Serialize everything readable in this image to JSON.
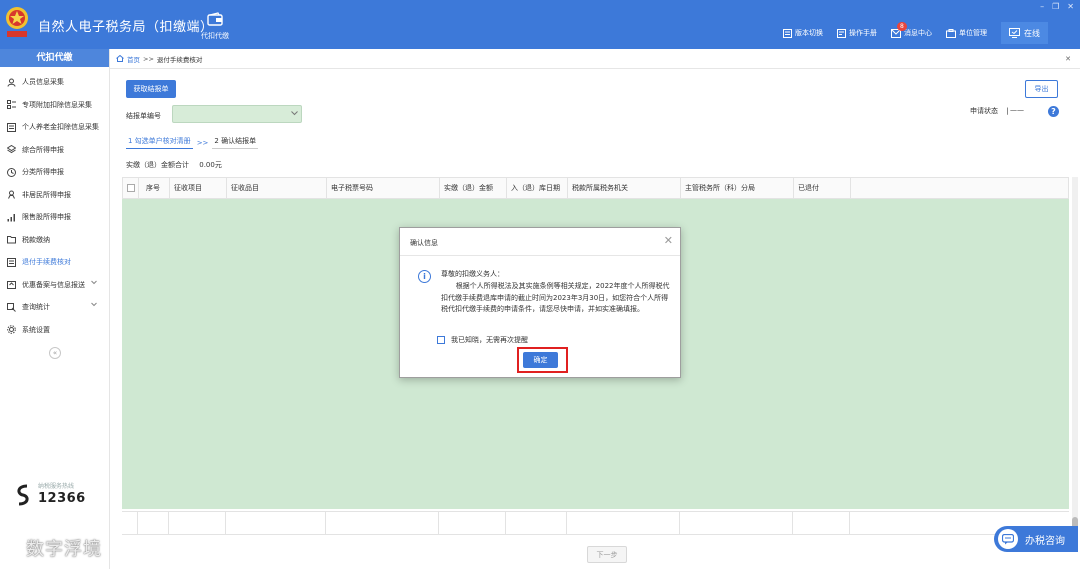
{
  "header": {
    "app_title": "自然人电子税务局（扣缴端）",
    "module_label": "代扣代缴",
    "actions": [
      {
        "label": "版本切换",
        "icon": "version-icon"
      },
      {
        "label": "操作手册",
        "icon": "manual-icon"
      },
      {
        "label": "消息中心",
        "icon": "message-icon",
        "badge": "8"
      },
      {
        "label": "单位管理",
        "icon": "org-icon"
      }
    ],
    "online_label": "在线",
    "colors": {
      "primary": "#3d79d9",
      "sidebar_head": "#4e86dc",
      "table_body": "#cfe8d2",
      "highlight": "#e02020"
    }
  },
  "sidebar": {
    "title": "代扣代缴",
    "items": [
      {
        "label": "人员信息采集",
        "icon": "person-icon"
      },
      {
        "label": "专项附加扣除信息采集",
        "icon": "list-icon"
      },
      {
        "label": "个人养老金扣除信息采集",
        "icon": "doc-icon"
      },
      {
        "label": "综合所得申报",
        "icon": "layers-icon"
      },
      {
        "label": "分类所得申报",
        "icon": "clock-icon"
      },
      {
        "label": "非居民所得申报",
        "icon": "person-outline-icon"
      },
      {
        "label": "限售股所得申报",
        "icon": "chart-icon"
      },
      {
        "label": "税款缴纳",
        "icon": "folder-icon"
      },
      {
        "label": "退付手续费核对",
        "icon": "receipt-icon"
      },
      {
        "label": "优惠备案与信息报送",
        "icon": "upload-icon"
      },
      {
        "label": "查询统计",
        "icon": "search-icon"
      },
      {
        "label": "系统设置",
        "icon": "gear-icon"
      }
    ],
    "collapse_glyph": "«",
    "hotline_caption": "纳税服务热线",
    "hotline_number": "12366",
    "watermark": "数字浮境"
  },
  "breadcrumb": {
    "home": "首页",
    "separator": ">>",
    "current": "退付手续费核对",
    "close_glyph": "✕"
  },
  "toolbar": {
    "fetch_button": "获取结报单",
    "export_button": "导出",
    "settlement_label": "结报单编号",
    "settlement_value": "",
    "status_label": "申请状态",
    "status_divider": "|",
    "status_value": "——",
    "help_glyph": "?"
  },
  "steps": {
    "step1": "1 勾选单户核对清册",
    "arrow": ">>",
    "step2": "2 确认结报单"
  },
  "totals": {
    "label": "实缴（退）金额合计",
    "value": "0.00元"
  },
  "table": {
    "columns": [
      "序号",
      "征收项目",
      "征收品目",
      "电子税票号码",
      "实缴（退）金额",
      "入（退）库日期",
      "税款所属税务机关",
      "主管税务所（科）分局",
      "已退付"
    ]
  },
  "footer": {
    "next_button": "下一步",
    "consult_button": "办税咨询"
  },
  "modal": {
    "title": "确认信息",
    "close_glyph": "✕",
    "info_glyph": "i",
    "greeting": "尊敬的扣缴义务人：",
    "message": "根据个人所得税法及其实施条例等相关规定，2022年度个人所得税代扣代缴手续费退库申请的截止时间为2023年3月30日，如您符合个人所得税代扣代缴手续费的申请条件，请您尽快申请，并如实准确填报。",
    "remember_label": "我已知晓，无需再次提醒",
    "confirm_button": "确定"
  }
}
